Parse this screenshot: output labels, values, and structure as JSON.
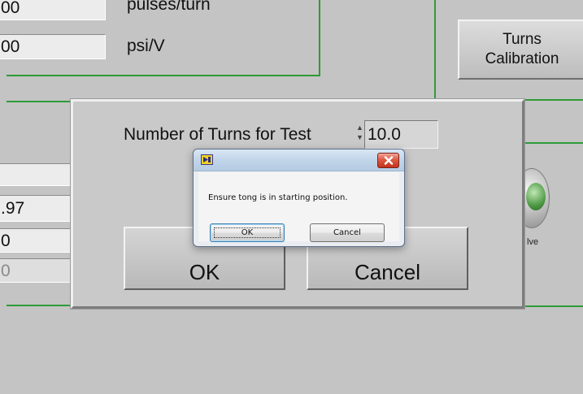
{
  "background": {
    "fields_top": [
      {
        "value": "00",
        "unit": "pulses/turn"
      },
      {
        "value": "00",
        "unit": "psi/V"
      }
    ],
    "fields_left": [
      {
        "value": ""
      },
      {
        "value": ".97"
      },
      {
        "value": "0"
      },
      {
        "value": "0"
      }
    ],
    "turns_calibration_button": {
      "line1": "Turns",
      "line2": "Calibration"
    },
    "valve_label": "lve",
    "accent_color": "#2f9a38"
  },
  "turns_dialog": {
    "field_label": "Number of Turns for Test",
    "field_value": "10.0",
    "ok_label": "OK",
    "cancel_label": "Cancel"
  },
  "message_box": {
    "title": "",
    "message": "Ensure tong is in starting position.",
    "ok_label": "OK",
    "cancel_label": "Cancel",
    "icons": {
      "app": "labview-app-icon",
      "close": "close-icon"
    }
  }
}
